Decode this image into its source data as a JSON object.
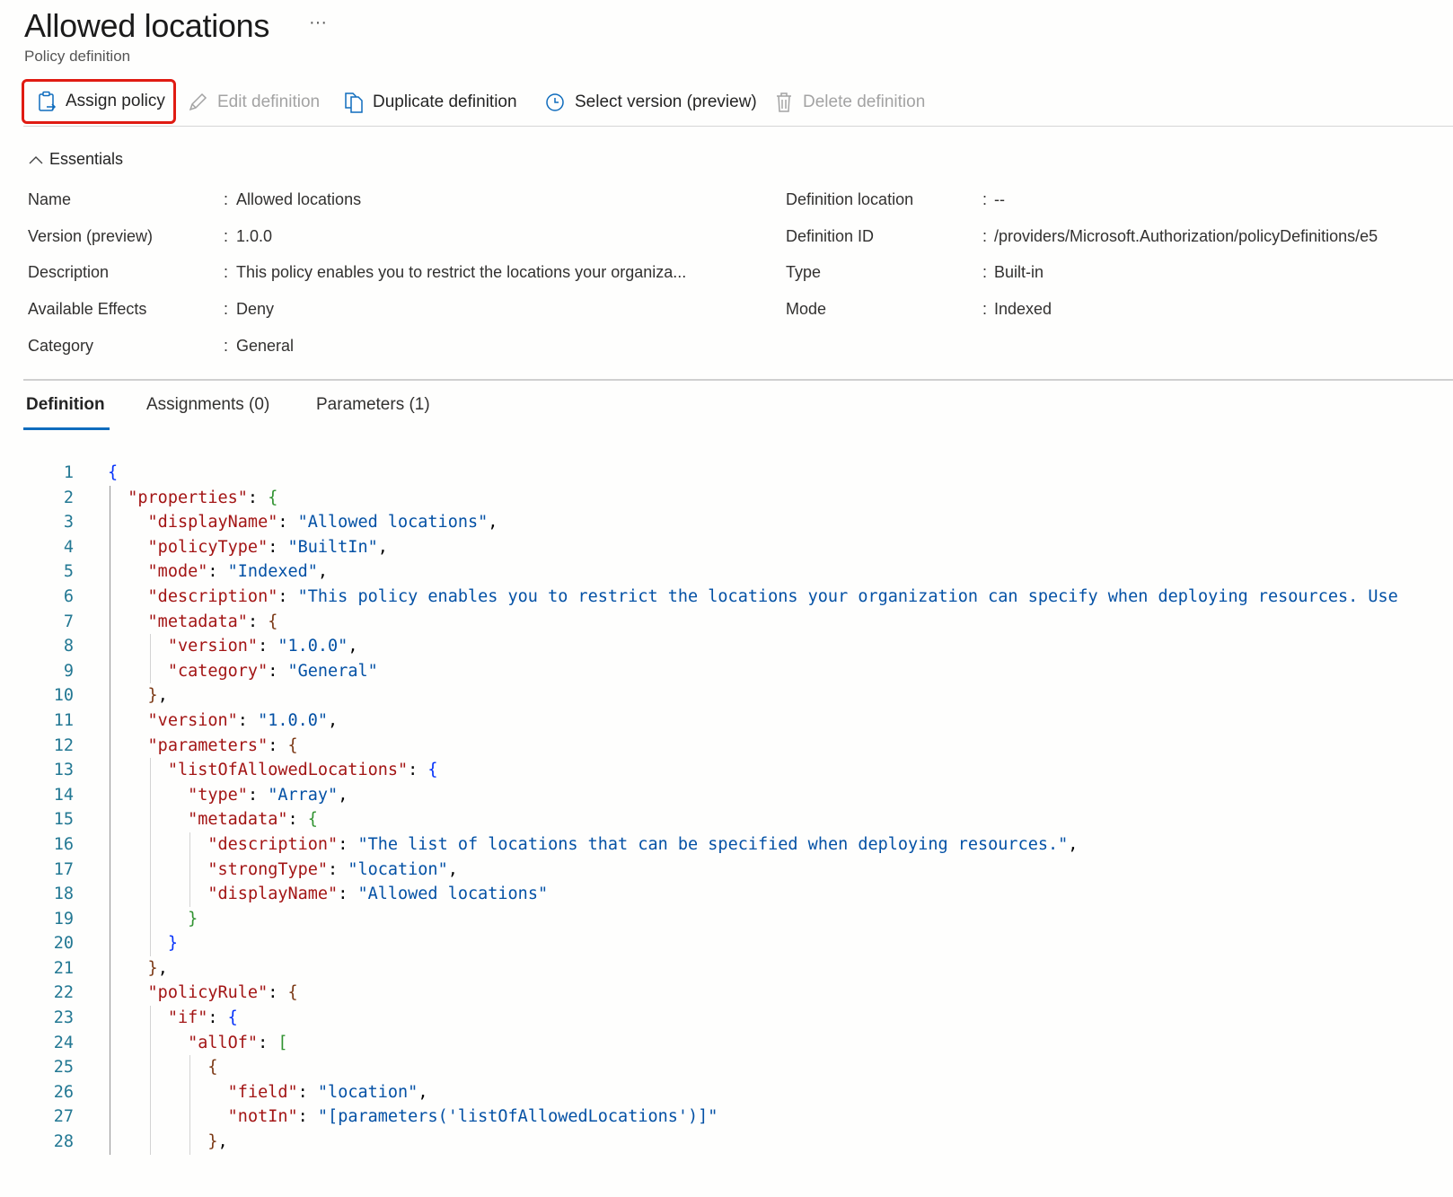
{
  "header": {
    "title": "Allowed locations",
    "more": "···",
    "subtitle": "Policy definition"
  },
  "toolbar": {
    "assign_policy": "Assign policy",
    "edit_definition": "Edit definition",
    "duplicate_definition": "Duplicate definition",
    "select_version": "Select version (preview)",
    "delete_definition": "Delete definition"
  },
  "essentials": {
    "toggle_label": "Essentials",
    "left": [
      {
        "label": "Name",
        "value": "Allowed locations"
      },
      {
        "label": "Version (preview)",
        "value": "1.0.0"
      },
      {
        "label": "Description",
        "value": "This policy enables you to restrict the locations your organiza..."
      },
      {
        "label": "Available Effects",
        "value": "Deny"
      },
      {
        "label": "Category",
        "value": "General"
      }
    ],
    "right": [
      {
        "label": "Definition location",
        "value": "--"
      },
      {
        "label": "Definition ID",
        "value": "/providers/Microsoft.Authorization/policyDefinitions/e5"
      },
      {
        "label": "Type",
        "value": "Built-in"
      },
      {
        "label": "Mode",
        "value": "Indexed"
      }
    ]
  },
  "tabs": [
    {
      "label": "Definition",
      "active": true
    },
    {
      "label": "Assignments (0)",
      "active": false
    },
    {
      "label": "Parameters (1)",
      "active": false
    }
  ],
  "colors": {
    "accent": "#0f6cbd",
    "highlight_box": "#e01b12",
    "json_key": "#a31515",
    "json_string": "#0451a5",
    "line_number": "#237893"
  },
  "code": [
    {
      "n": "1",
      "indent": 0,
      "t": [
        [
          "b0",
          "{"
        ]
      ]
    },
    {
      "n": "2",
      "indent": 2,
      "t": [
        [
          "k",
          "\"properties\""
        ],
        [
          "p",
          ": "
        ],
        [
          "b1",
          "{"
        ]
      ]
    },
    {
      "n": "3",
      "indent": 4,
      "t": [
        [
          "k",
          "\"displayName\""
        ],
        [
          "p",
          ": "
        ],
        [
          "s",
          "\"Allowed locations\""
        ],
        [
          "p",
          ","
        ]
      ]
    },
    {
      "n": "4",
      "indent": 4,
      "t": [
        [
          "k",
          "\"policyType\""
        ],
        [
          "p",
          ": "
        ],
        [
          "s",
          "\"BuiltIn\""
        ],
        [
          "p",
          ","
        ]
      ]
    },
    {
      "n": "5",
      "indent": 4,
      "t": [
        [
          "k",
          "\"mode\""
        ],
        [
          "p",
          ": "
        ],
        [
          "s",
          "\"Indexed\""
        ],
        [
          "p",
          ","
        ]
      ]
    },
    {
      "n": "6",
      "indent": 4,
      "t": [
        [
          "k",
          "\"description\""
        ],
        [
          "p",
          ": "
        ],
        [
          "s",
          "\"This policy enables you to restrict the locations your organization can specify when deploying resources. Use"
        ]
      ]
    },
    {
      "n": "7",
      "indent": 4,
      "t": [
        [
          "k",
          "\"metadata\""
        ],
        [
          "p",
          ": "
        ],
        [
          "b2",
          "{"
        ]
      ]
    },
    {
      "n": "8",
      "indent": 6,
      "t": [
        [
          "k",
          "\"version\""
        ],
        [
          "p",
          ": "
        ],
        [
          "s",
          "\"1.0.0\""
        ],
        [
          "p",
          ","
        ]
      ]
    },
    {
      "n": "9",
      "indent": 6,
      "t": [
        [
          "k",
          "\"category\""
        ],
        [
          "p",
          ": "
        ],
        [
          "s",
          "\"General\""
        ]
      ]
    },
    {
      "n": "10",
      "indent": 4,
      "t": [
        [
          "b2",
          "}"
        ],
        [
          "p",
          ","
        ]
      ]
    },
    {
      "n": "11",
      "indent": 4,
      "t": [
        [
          "k",
          "\"version\""
        ],
        [
          "p",
          ": "
        ],
        [
          "s",
          "\"1.0.0\""
        ],
        [
          "p",
          ","
        ]
      ]
    },
    {
      "n": "12",
      "indent": 4,
      "t": [
        [
          "k",
          "\"parameters\""
        ],
        [
          "p",
          ": "
        ],
        [
          "b2",
          "{"
        ]
      ]
    },
    {
      "n": "13",
      "indent": 6,
      "t": [
        [
          "k",
          "\"listOfAllowedLocations\""
        ],
        [
          "p",
          ": "
        ],
        [
          "b0",
          "{"
        ]
      ]
    },
    {
      "n": "14",
      "indent": 8,
      "t": [
        [
          "k",
          "\"type\""
        ],
        [
          "p",
          ": "
        ],
        [
          "s",
          "\"Array\""
        ],
        [
          "p",
          ","
        ]
      ]
    },
    {
      "n": "15",
      "indent": 8,
      "t": [
        [
          "k",
          "\"metadata\""
        ],
        [
          "p",
          ": "
        ],
        [
          "b1",
          "{"
        ]
      ]
    },
    {
      "n": "16",
      "indent": 10,
      "t": [
        [
          "k",
          "\"description\""
        ],
        [
          "p",
          ": "
        ],
        [
          "s",
          "\"The list of locations that can be specified when deploying resources.\""
        ],
        [
          "p",
          ","
        ]
      ]
    },
    {
      "n": "17",
      "indent": 10,
      "t": [
        [
          "k",
          "\"strongType\""
        ],
        [
          "p",
          ": "
        ],
        [
          "s",
          "\"location\""
        ],
        [
          "p",
          ","
        ]
      ]
    },
    {
      "n": "18",
      "indent": 10,
      "t": [
        [
          "k",
          "\"displayName\""
        ],
        [
          "p",
          ": "
        ],
        [
          "s",
          "\"Allowed locations\""
        ]
      ]
    },
    {
      "n": "19",
      "indent": 8,
      "t": [
        [
          "b1",
          "}"
        ]
      ]
    },
    {
      "n": "20",
      "indent": 6,
      "t": [
        [
          "b0",
          "}"
        ]
      ]
    },
    {
      "n": "21",
      "indent": 4,
      "t": [
        [
          "b2",
          "}"
        ],
        [
          "p",
          ","
        ]
      ]
    },
    {
      "n": "22",
      "indent": 4,
      "t": [
        [
          "k",
          "\"policyRule\""
        ],
        [
          "p",
          ": "
        ],
        [
          "b2",
          "{"
        ]
      ]
    },
    {
      "n": "23",
      "indent": 6,
      "t": [
        [
          "k",
          "\"if\""
        ],
        [
          "p",
          ": "
        ],
        [
          "b0",
          "{"
        ]
      ]
    },
    {
      "n": "24",
      "indent": 8,
      "t": [
        [
          "k",
          "\"allOf\""
        ],
        [
          "p",
          ": "
        ],
        [
          "b1",
          "["
        ]
      ]
    },
    {
      "n": "25",
      "indent": 10,
      "t": [
        [
          "b2",
          "{"
        ]
      ]
    },
    {
      "n": "26",
      "indent": 12,
      "t": [
        [
          "k",
          "\"field\""
        ],
        [
          "p",
          ": "
        ],
        [
          "s",
          "\"location\""
        ],
        [
          "p",
          ","
        ]
      ]
    },
    {
      "n": "27",
      "indent": 12,
      "t": [
        [
          "k",
          "\"notIn\""
        ],
        [
          "p",
          ": "
        ],
        [
          "s",
          "\"[parameters('listOfAllowedLocations')]\""
        ]
      ]
    },
    {
      "n": "28",
      "indent": 10,
      "t": [
        [
          "b2",
          "}"
        ],
        [
          "p",
          ","
        ]
      ]
    }
  ]
}
